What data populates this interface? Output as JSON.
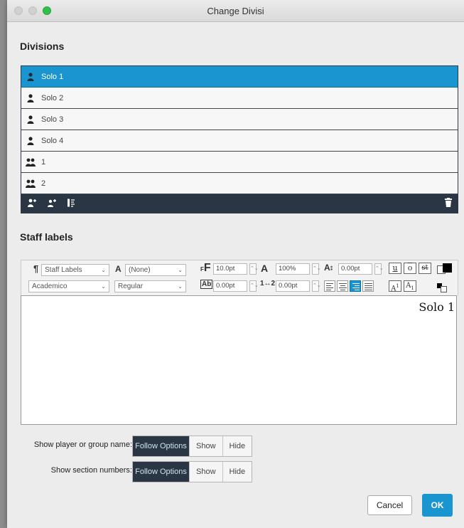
{
  "window": {
    "title": "Change Divisi"
  },
  "divisions": {
    "heading": "Divisions",
    "items": [
      {
        "label": "Solo 1",
        "icon": "person-icon",
        "selected": true
      },
      {
        "label": "Solo 2",
        "icon": "person-icon",
        "selected": false
      },
      {
        "label": "Solo 3",
        "icon": "person-icon",
        "selected": false
      },
      {
        "label": "Solo 4",
        "icon": "person-icon",
        "selected": false
      },
      {
        "label": "1",
        "icon": "group-icon",
        "selected": false
      },
      {
        "label": "2",
        "icon": "group-icon",
        "selected": false
      }
    ]
  },
  "staff_labels": {
    "heading": "Staff labels",
    "paragraph_style": "Staff Labels",
    "character_style": "(None)",
    "font": "Academico",
    "font_style": "Regular",
    "font_size": "10.0pt",
    "scale": "100%",
    "baseline_shift": "0.00pt",
    "tracking": "0.00pt",
    "line_spacing": "0.00pt",
    "editor_text": "Solo 1"
  },
  "options": {
    "player_label": "Show player or group name:",
    "section_label": "Show section numbers:",
    "choices": [
      "Follow Options",
      "Show",
      "Hide"
    ]
  },
  "buttons": {
    "cancel": "Cancel",
    "ok": "OK"
  },
  "colors": {
    "accent": "#1a95cf",
    "dark": "#2a3643"
  }
}
